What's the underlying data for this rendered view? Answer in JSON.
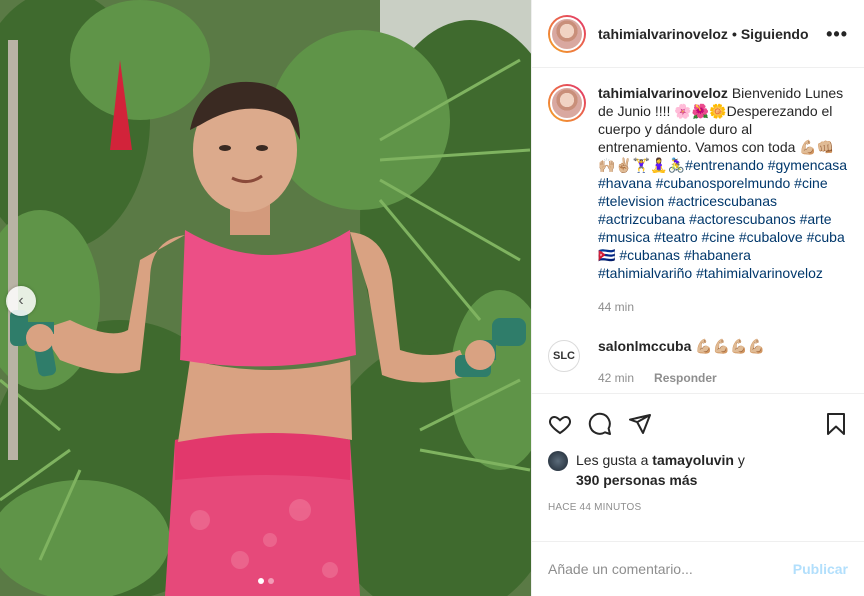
{
  "post": {
    "username": "tahimialvarinoveloz",
    "separator": "•",
    "follow_label": "Siguiendo",
    "more_label": "•••"
  },
  "photo": {
    "prev_label": "‹",
    "slide_count": 2,
    "active_slide": 1
  },
  "caption": {
    "username": "tahimialvarinoveloz",
    "text": "Bienvenido Lunes de Junio !!!! 🌸🌺🌼Desperezando el cuerpo y dándole duro al entrenamiento. Vamos con toda 💪🏼👊🏼🙌🏼✌🏼🏋️‍♀️🧘‍♀️🚴‍♀️",
    "hashtags": [
      "#entrenando",
      "#gymencasa",
      "#havana",
      "#cubanosporelmundo",
      "#cine",
      "#television",
      "#actricescubanas",
      "#actrizcubana",
      "#actorescubanos",
      "#arte",
      "#musica",
      "#teatro",
      "#cine",
      "#cubalove",
      "#cuba🇨🇺",
      "#cubanas",
      "#habanera",
      "#tahimialvariño",
      "#tahimialvarinoveloz"
    ],
    "time": "44 min"
  },
  "comment": {
    "avatar_label": "SLC",
    "username": "salonlmccuba",
    "text": "💪🏼💪🏼💪🏼💪🏼",
    "time": "42 min",
    "reply_label": "Responder"
  },
  "likes": {
    "prefix": "Les gusta a",
    "liker": "tamayoluvin",
    "conjunction": "y",
    "others": "390 personas más"
  },
  "timestamp": "HACE 44 MINUTOS",
  "add_comment": {
    "placeholder": "Añade un comentario...",
    "publish_label": "Publicar"
  },
  "colors": {
    "hashtag": "#00376b",
    "publish_disabled": "#b2dffc",
    "muted": "#8e8e8e"
  }
}
